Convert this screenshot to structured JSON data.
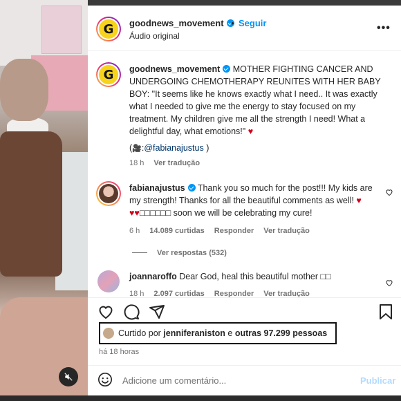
{
  "post": {
    "author": "goodnews_movement",
    "follow_label": "Seguir",
    "dot": "•",
    "audio_label": "Áudio original",
    "more_label": "•••"
  },
  "caption": {
    "author": "goodnews_movement",
    "text": "MOTHER FIGHTING CANCER AND UNDERGOING CHEMOTHERAPY REUNITES WITH HER BABY BOY: \"It seems like he knows exactly what I need.. It was exactly what I needed to give me the energy to stay focused on my treatment. My children give me all the strength I need! What a delightful day, what emotions!\"",
    "heart": "♥",
    "credit_prefix": "(",
    "credit_camera": "🎥",
    "credit_user": "@fabianajustus",
    "credit_suffix": " )",
    "time": "18 h",
    "translate_label": "Ver tradução"
  },
  "comments": [
    {
      "user": "fabianajustus",
      "text": "Thank you so much for the post!!! My kids are my strength! Thanks for all the beautiful comments as well!",
      "line2_hearts": "♥♥",
      "line2_placeholder": "□□□□□□",
      "line2_text": " soon we will be celebrating my cure!",
      "heart": "♥",
      "time": "6 h",
      "likes": "14.089 curtidas",
      "reply_label": "Responder",
      "translate_label": "Ver tradução",
      "view_replies": "Ver respostas (532)"
    },
    {
      "user": "joannaroffo",
      "text": "Dear God, heal this beautiful mother",
      "placeholder": "□□",
      "time": "18 h",
      "likes": "2.097 curtidas",
      "reply_label": "Responder",
      "translate_label": "Ver tradução"
    }
  ],
  "likes": {
    "prefix": "Curtido por ",
    "user": "jenniferaniston",
    "middle": " e ",
    "others": "outras 97.299 pessoas"
  },
  "time_ago": "há 18 horas",
  "comment_input": {
    "placeholder": "Adicione um comentário...",
    "publish_label": "Publicar"
  },
  "icons": {
    "verified": "verified-badge-icon",
    "heart": "heart-icon",
    "comment": "comment-icon",
    "share": "share-icon",
    "save": "bookmark-icon",
    "emoji": "emoji-icon",
    "mute": "mute-icon"
  },
  "colors": {
    "accent": "#0095f6",
    "heart": "#d0021b",
    "muted_text": "#737373",
    "publish_disabled": "#b3dbff"
  }
}
